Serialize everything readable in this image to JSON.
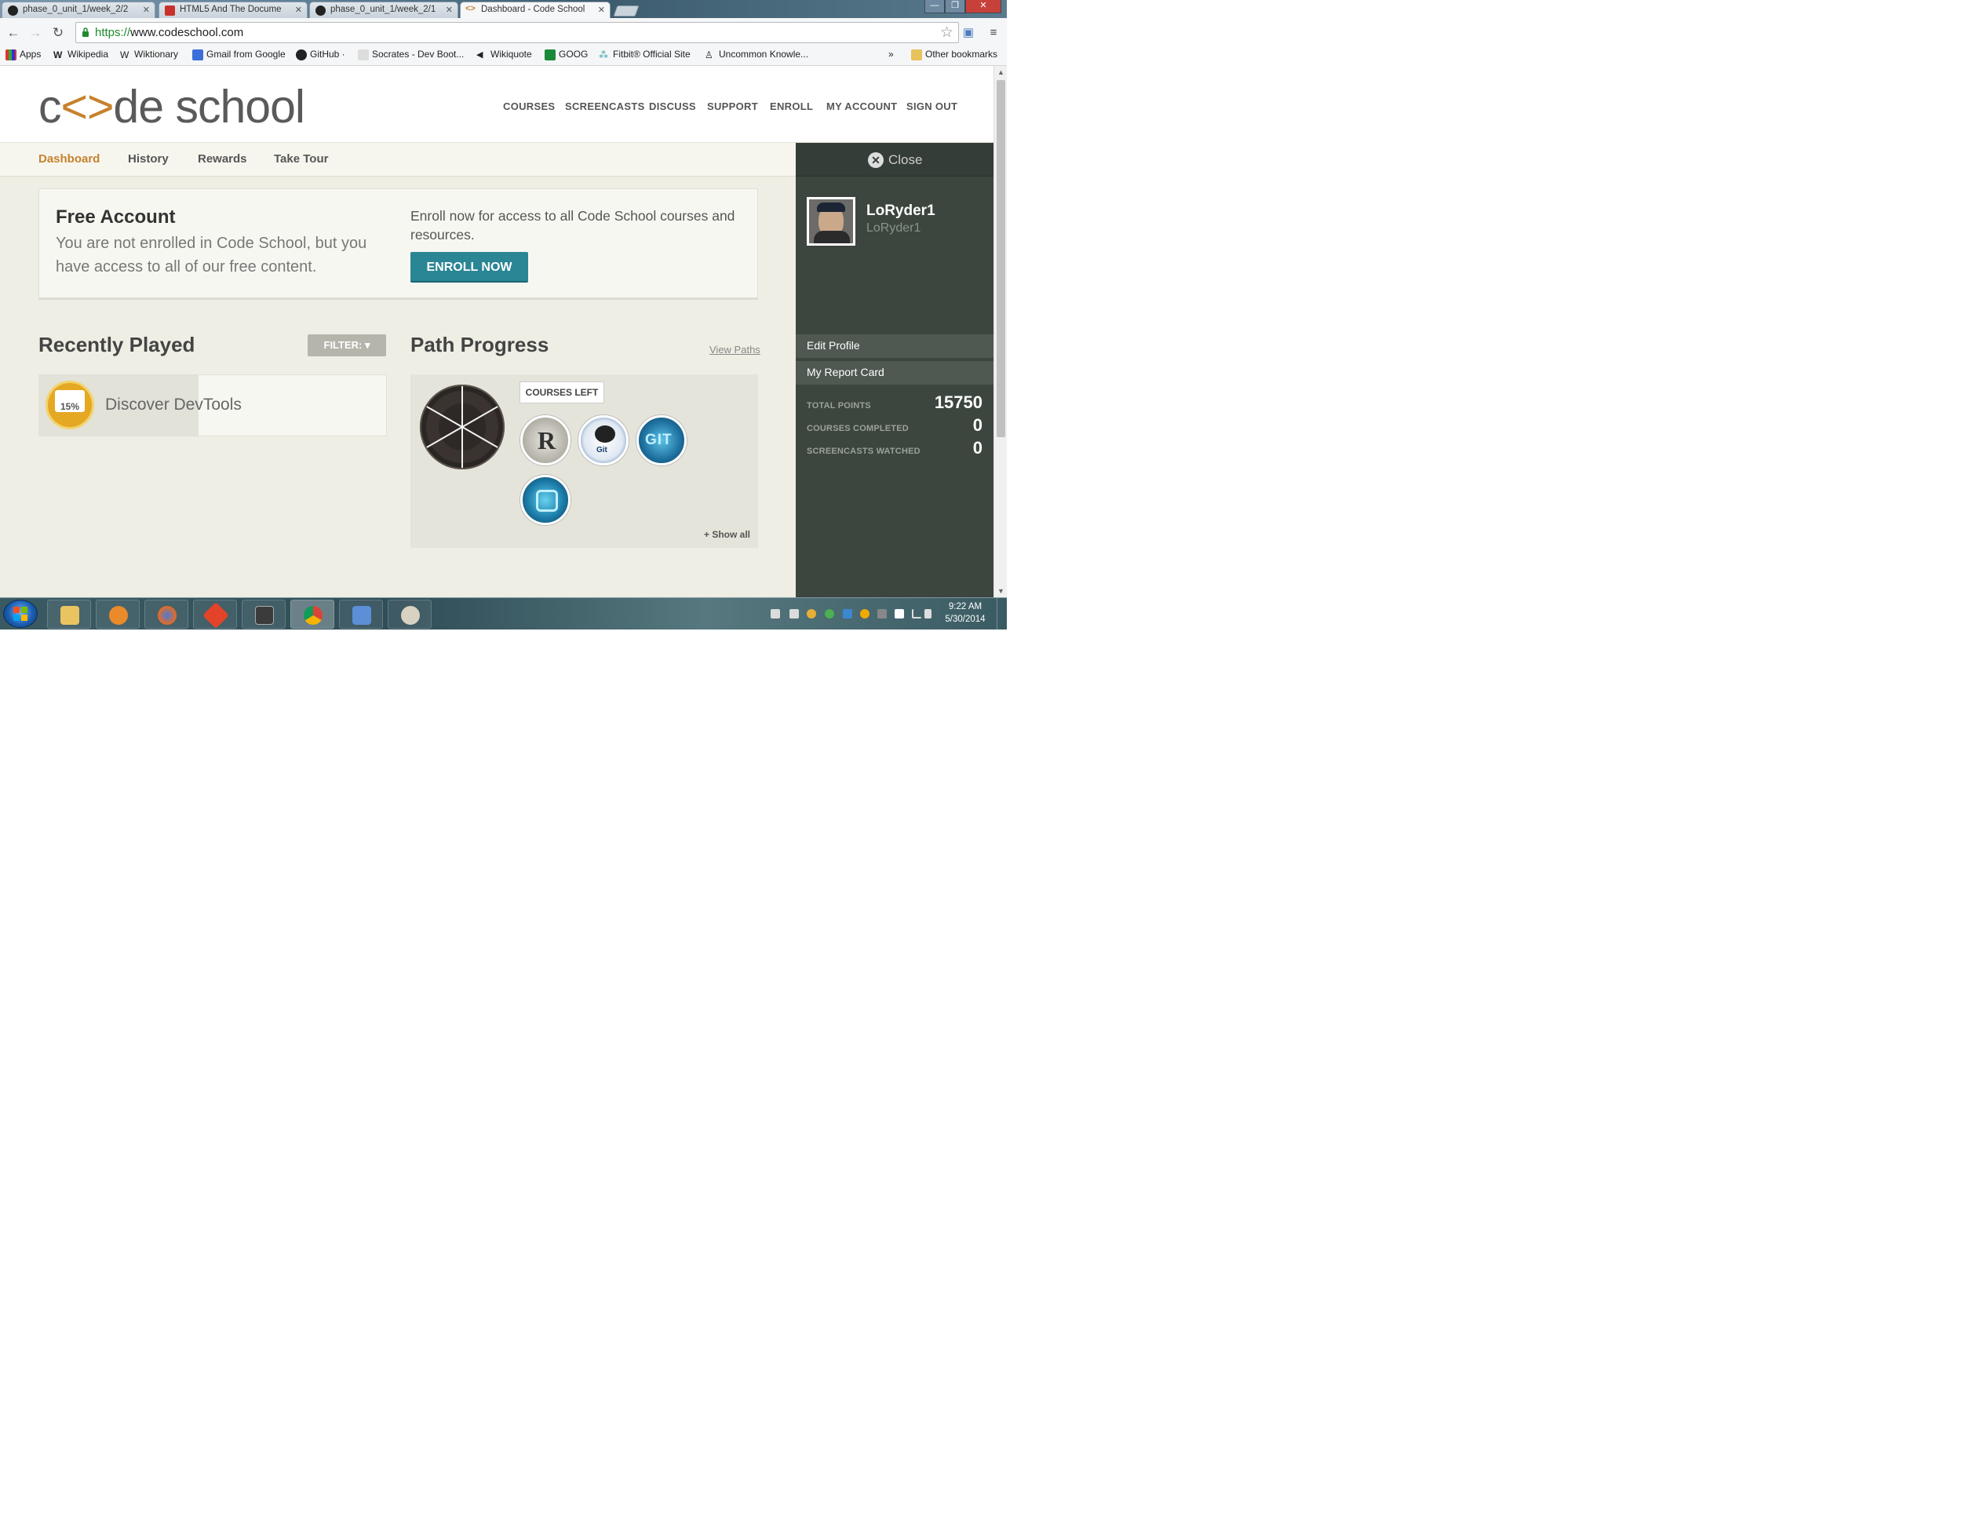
{
  "browser": {
    "tabs": [
      {
        "label": "phase_0_unit_1/week_2/2",
        "icon": "github-icon"
      },
      {
        "label": "HTML5 And The Docume",
        "icon": "pdf-icon"
      },
      {
        "label": "phase_0_unit_1/week_2/1",
        "icon": "github-icon"
      },
      {
        "label": "Dashboard - Code School",
        "icon": "codeschool-icon"
      }
    ],
    "url_scheme": "https://",
    "url_host": "www.codeschool.com",
    "bookmarks": [
      {
        "label": "Apps"
      },
      {
        "label": "Wikipedia"
      },
      {
        "label": "Wiktionary"
      },
      {
        "label": "Gmail from Google"
      },
      {
        "label": "GitHub ·"
      },
      {
        "label": "Socrates - Dev Boot..."
      },
      {
        "label": "Wikiquote"
      },
      {
        "label": "GOOG"
      },
      {
        "label": "Fitbit® Official Site"
      },
      {
        "label": "Uncommon Knowle..."
      }
    ],
    "more_bookmarks": "»",
    "other_bookmarks": "Other bookmarks"
  },
  "site": {
    "logo": {
      "pre": "c",
      "bracket": "<>",
      "post": "de school"
    },
    "nav": [
      "COURSES",
      "SCREENCASTS",
      "DISCUSS",
      "SUPPORT",
      "ENROLL",
      "MY ACCOUNT",
      "SIGN OUT"
    ],
    "subnav": [
      "Dashboard",
      "History",
      "Rewards",
      "Take Tour"
    ],
    "active_subnav": "Dashboard",
    "colors": {
      "accent": "#c6822c",
      "enroll_button": "#2a8594",
      "sidebar": "#3c463f"
    }
  },
  "free_account": {
    "title": "Free Account",
    "description": "You are not enrolled in Code School, but you have access to all of our free content.",
    "enroll_text": "Enroll now for access to all Code School courses and resources.",
    "enroll_button": "ENROLL NOW"
  },
  "recently_played": {
    "title": "Recently Played",
    "filter_label": "FILTER: ▾",
    "items": [
      {
        "name": "Discover DevTools",
        "badge_text": "15%",
        "progress_percent": 46
      }
    ]
  },
  "path_progress": {
    "title": "Path Progress",
    "view_paths": "View Paths",
    "courses_left_label": "COURSES LEFT",
    "courses": [
      "r-icon",
      "git-octocat-icon",
      "git-real-icon",
      "javascript-icon"
    ],
    "show_all": "+ Show all"
  },
  "sidebar": {
    "close_label": "Close",
    "username": "LoRyder1",
    "handle": "LoRyder1",
    "links": [
      "Edit Profile",
      "My Report Card"
    ],
    "stats": [
      {
        "label": "TOTAL POINTS",
        "value": "15750"
      },
      {
        "label": "COURSES COMPLETED",
        "value": "0"
      },
      {
        "label": "SCREENCASTS WATCHED",
        "value": "0"
      }
    ]
  },
  "taskbar": {
    "apps": [
      "file-explorer-icon",
      "media-player-icon",
      "firefox-icon",
      "git-icon",
      "sublime-text-icon",
      "chrome-icon",
      "remote-icon",
      "paint-icon"
    ],
    "active_app": "chrome-icon",
    "time": "9:22 AM",
    "date": "5/30/2014"
  }
}
